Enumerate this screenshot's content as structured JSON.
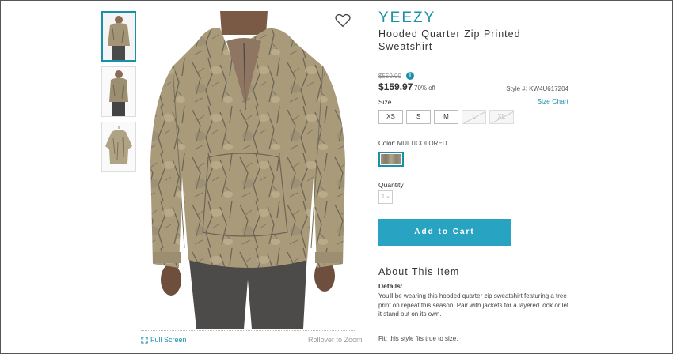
{
  "product": {
    "brand": "YEEZY",
    "title": "Hooded Quarter Zip Printed Sweatshirt",
    "original_price": "$550.00",
    "price": "$159.97",
    "discount": "70% off",
    "style_number": "Style #: KW4U617204"
  },
  "size": {
    "label": "Size",
    "chart_link": "Size Chart",
    "options": [
      {
        "label": "XS",
        "available": true
      },
      {
        "label": "S",
        "available": true
      },
      {
        "label": "M",
        "available": true
      },
      {
        "label": "L",
        "available": false
      },
      {
        "label": "XL",
        "available": false
      }
    ]
  },
  "color": {
    "label": "Color:",
    "value": "MULTICOLORED"
  },
  "quantity": {
    "label": "Quantity",
    "value": "1"
  },
  "actions": {
    "add_to_cart": "Add to Cart",
    "full_screen": "Full Screen",
    "rollover": "Rollover to Zoom"
  },
  "about": {
    "heading": "About This Item",
    "details_label": "Details:",
    "description": "You'll be wearing this hooded quarter zip sweatshirt featuring a tree print on repeat this season. Pair with jackets for a layered look or let it stand out on its own.",
    "fit": "Fit: this style fits true to size."
  },
  "icons": {
    "wishlist": "heart-icon",
    "info": "info-icon",
    "fullscreen": "expand-icon"
  },
  "colors": {
    "accent": "#1a8fa8",
    "cart_button": "#28a4c2"
  }
}
